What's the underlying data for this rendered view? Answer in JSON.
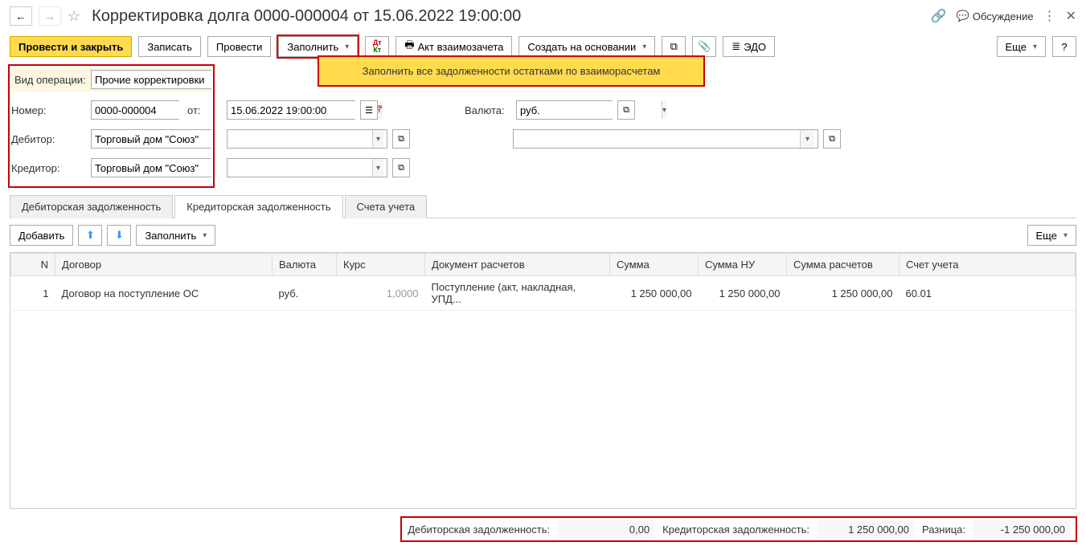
{
  "header": {
    "title": "Корректировка долга 0000-000004 от 15.06.2022 19:00:00",
    "discuss": "Обсуждение"
  },
  "toolbar": {
    "post_close": "Провести и закрыть",
    "save": "Записать",
    "post": "Провести",
    "fill": "Заполнить",
    "act": "Акт взаимозачета",
    "create_based": "Создать на основании",
    "edo": "ЭДО",
    "more": "Еще",
    "fill_menu_item": "Заполнить все задолженности остатками по взаиморасчетам"
  },
  "form": {
    "operation_type_label": "Вид операции:",
    "operation_type": "Прочие корректировки",
    "number_label": "Номер:",
    "number": "0000-000004",
    "date_label": "от:",
    "date": "15.06.2022 19:00:00",
    "currency_label": "Валюта:",
    "currency": "руб.",
    "debtor_label": "Дебитор:",
    "debtor": "Торговый дом \"Союз\"",
    "creditor_label": "Кредитор:",
    "creditor": "Торговый дом \"Союз\""
  },
  "tabs": {
    "debtor_debt": "Дебиторская задолженность",
    "creditor_debt": "Кредиторская задолженность",
    "accounts": "Счета учета"
  },
  "table_toolbar": {
    "add": "Добавить",
    "fill": "Заполнить",
    "more": "Еще"
  },
  "table": {
    "headers": {
      "n": "N",
      "contract": "Договор",
      "currency": "Валюта",
      "rate": "Курс",
      "doc": "Документ расчетов",
      "sum": "Сумма",
      "sum_nu": "Сумма НУ",
      "sum_calc": "Сумма расчетов",
      "account": "Счет учета"
    },
    "rows": [
      {
        "n": "1",
        "contract": "Договор на поступление ОС",
        "currency": "руб.",
        "rate": "1,0000",
        "doc": "Поступление (акт, накладная, УПД...",
        "sum": "1 250 000,00",
        "sum_nu": "1 250 000,00",
        "sum_calc": "1 250 000,00",
        "account": "60.01"
      }
    ]
  },
  "footer": {
    "debtor_label": "Дебиторская задолженность:",
    "debtor_val": "0,00",
    "creditor_label": "Кредиторская задолженность:",
    "creditor_val": "1 250 000,00",
    "diff_label": "Разница:",
    "diff_val": "-1 250 000,00"
  }
}
